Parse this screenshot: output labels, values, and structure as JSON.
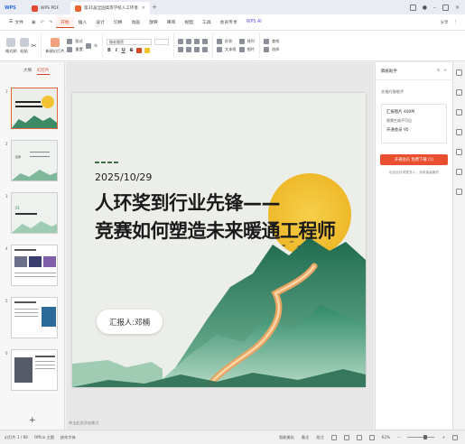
{
  "app": {
    "home_tab": "WPS",
    "pdf_tab": "WPS PDF",
    "doc_tab": "第31届全国高等学校人工环境",
    "accent": "#d24726",
    "brand": "#2b6be6"
  },
  "menu": {
    "file": "文件",
    "items": [
      "开始",
      "插入",
      "设计",
      "切换",
      "动画",
      "放映",
      "审阅",
      "视图",
      "工具",
      "会员专享"
    ],
    "active": "开始",
    "wps_ai": "WPS AI",
    "right": [
      "分享",
      "⋮"
    ]
  },
  "ribbon": {
    "format_painter": "格式刷",
    "paste": "粘贴",
    "cut": "✂",
    "new_slide": "新建幻灯片",
    "layout": "版式",
    "reset": "重置",
    "section": "节",
    "font_name": "微软雅黑",
    "bold": "B",
    "italic": "I",
    "underline": "U",
    "strike": "S",
    "shape": "形状",
    "textbox": "文本框",
    "arrange": "排列",
    "picture": "图片",
    "find": "查找",
    "select": "选择"
  },
  "left_panel": {
    "tab_outline": "大纲",
    "tab_slides": "幻灯片",
    "slides": [
      {
        "num": "1",
        "title": ""
      },
      {
        "num": "2",
        "title": "目录"
      },
      {
        "num": "3",
        "title": "01"
      },
      {
        "num": "4",
        "title": ""
      },
      {
        "num": "5",
        "title": ""
      },
      {
        "num": "6",
        "title": ""
      }
    ],
    "add": "+"
  },
  "slide": {
    "date": "2025/10/29",
    "title_line1": "人环奖到行业先锋——",
    "title_line2": "竞赛如何塑造未来暖通工程师",
    "presenter": "汇报人:邓楠",
    "sun_color": "#f2c233",
    "mountain_color": "#2f7a5c",
    "wall_color": "#e8a562"
  },
  "notes_placeholder": "单击此处添加备注",
  "right_panel": {
    "title": "稿纸助手",
    "subtitle": "文档问答助手",
    "card_name": "汇报图片 400M",
    "card_line2": "视频生成不可见",
    "card_line3": "开通会员  95",
    "button": "开通会员 免费下载 (1)",
    "note": "包含此处或更多人，领用量级最终"
  },
  "status_bar": {
    "slide_count": "幻灯片 1 / 66",
    "theme": "Office 主题",
    "missing_font": "缺失字体",
    "smart_beautify": "智能美化",
    "notes": "备注",
    "comment": "批注",
    "zoom": "62%"
  }
}
